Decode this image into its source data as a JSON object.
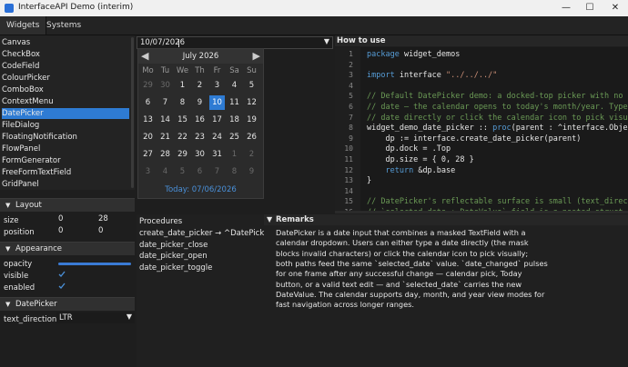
{
  "window": {
    "title": "InterfaceAPI Demo (interim)",
    "minimize": "—",
    "maximize": "☐",
    "close": "✕"
  },
  "tabs": [
    {
      "label": "Widgets"
    },
    {
      "label": "Systems"
    }
  ],
  "widget_list": [
    "Canvas",
    "CheckBox",
    "CodeField",
    "ColourPicker",
    "ComboBox",
    "ContextMenu",
    "DatePicker",
    "FileDialog",
    "FloatingNotification",
    "FlowPanel",
    "FormGenerator",
    "FreeFormTextField",
    "GridPanel"
  ],
  "selected_widget": "DatePicker",
  "date_field": {
    "value": "10/07/2026"
  },
  "calendar": {
    "month_label": "July 2026",
    "prev": "◀",
    "next": "▶",
    "weekdays": [
      "Mo",
      "Tu",
      "We",
      "Th",
      "Fr",
      "Sa",
      "Su"
    ],
    "rows": [
      [
        "29",
        "30",
        "1",
        "2",
        "3",
        "4",
        "5"
      ],
      [
        "6",
        "7",
        "8",
        "9",
        "10",
        "11",
        "12"
      ],
      [
        "13",
        "14",
        "15",
        "16",
        "17",
        "18",
        "19"
      ],
      [
        "20",
        "21",
        "22",
        "23",
        "24",
        "25",
        "26"
      ],
      [
        "27",
        "28",
        "29",
        "30",
        "31",
        "1",
        "2"
      ],
      [
        "3",
        "4",
        "5",
        "6",
        "7",
        "8",
        "9"
      ]
    ],
    "selected_day": "10",
    "today_label": "Today: 07/06/2026"
  },
  "how_to_use_title": "How to use",
  "code": [
    {
      "n": "1",
      "t": "package widget_demos"
    },
    {
      "n": "2",
      "t": ""
    },
    {
      "n": "3",
      "t": "import interface \"../../../\""
    },
    {
      "n": "4",
      "t": ""
    },
    {
      "n": "5",
      "t": "// Default DatePicker demo: a docked-top picker with no pre"
    },
    {
      "n": "6",
      "t": "// date — the calendar opens to today's month/year. Type a"
    },
    {
      "n": "7",
      "t": "// date directly or click the calendar icon to pick visuall"
    },
    {
      "n": "8",
      "t": "widget_demo_date_picker :: proc(parent : ^interface.Object)"
    },
    {
      "n": "9",
      "t": "    dp := interface.create_date_picker(parent)"
    },
    {
      "n": "10",
      "t": "    dp.dock = .Top"
    },
    {
      "n": "11",
      "t": "    dp.size = { 0, 28 }"
    },
    {
      "n": "12",
      "t": "    return &dp.base"
    },
    {
      "n": "13",
      "t": "}"
    },
    {
      "n": "14",
      "t": ""
    },
    {
      "n": "15",
      "t": "// DatePicker's reflectable surface is small (text_directio"
    },
    {
      "n": "16",
      "t": "// `selected_date : DateValue` field is a nested struct tha"
    }
  ],
  "layout": {
    "title": "Layout",
    "size_label": "size",
    "size_x": "0",
    "size_y": "28",
    "position_label": "position",
    "position_x": "0",
    "position_y": "0"
  },
  "appearance": {
    "title": "Appearance",
    "opacity_label": "opacity",
    "opacity_value": 1.0,
    "visible_label": "visible",
    "visible_checked": true,
    "enabled_label": "enabled",
    "enabled_checked": true
  },
  "datepicker_props": {
    "title": "DatePicker",
    "text_direction_label": "text_direction",
    "text_direction_value": "LTR"
  },
  "procedures": {
    "title": "Procedures",
    "items": [
      "create_date_picker → ^DatePicker",
      "date_picker_close",
      "date_picker_open",
      "date_picker_toggle"
    ]
  },
  "remarks": {
    "title": "Remarks",
    "lines": [
      "DatePicker is a date input that combines a masked TextField with a",
      "calendar dropdown. Users can either type a date directly (the mask",
      "blocks invalid characters) or click the calendar icon to pick visually;",
      "both paths feed the same `selected_date` value. `date_changed` pulses",
      "for one frame after any successful change — calendar pick, Today",
      "button, or a valid text edit — and `selected_date` carries the new",
      "DateValue. The calendar supports day, month, and year view modes for",
      "fast navigation across longer ranges."
    ]
  },
  "colors": {
    "accent": "#2e7bd3",
    "today": "#4a90d9",
    "keyword": "#569cd6",
    "comment": "#6a9955",
    "string": "#ce9178",
    "func": "#dcdcaa"
  }
}
